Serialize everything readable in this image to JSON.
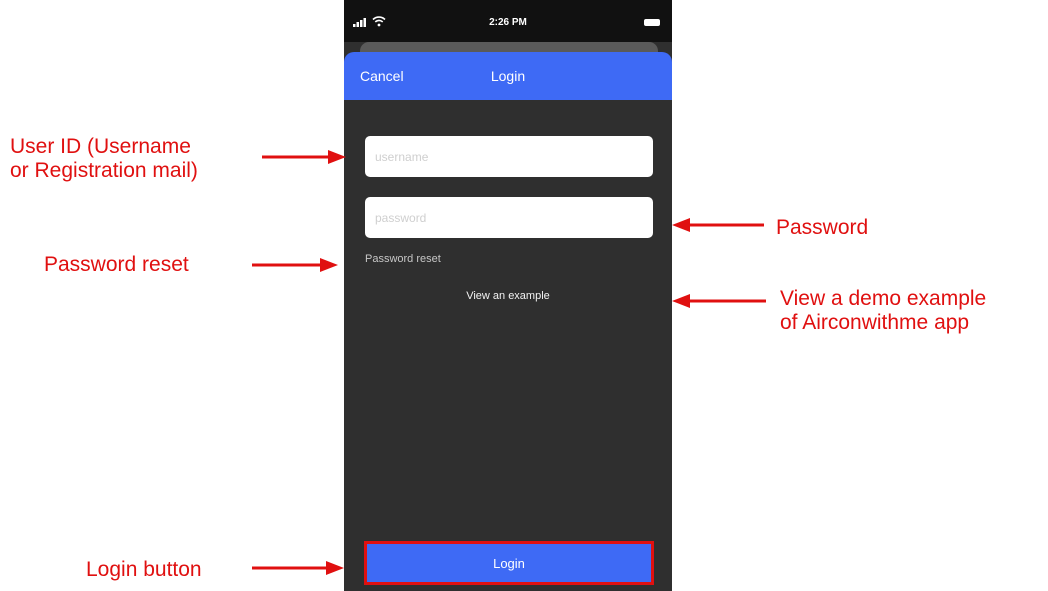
{
  "status_bar": {
    "time": "2:26 PM",
    "icons": [
      "signal-icon",
      "wifi-icon",
      "battery-icon"
    ]
  },
  "nav": {
    "cancel_label": "Cancel",
    "title": "Login"
  },
  "form": {
    "username_placeholder": "username",
    "username_value": "",
    "password_placeholder": "password",
    "password_value": "",
    "reset_label": "Password reset",
    "example_label": "View an example",
    "login_label": "Login"
  },
  "annotations": {
    "user_id": "User ID (Username\nor Registration mail)",
    "password": "Password",
    "password_reset": "Password reset",
    "demo": "View a demo example\nof Airconwithme app",
    "login_button": "Login button"
  },
  "colors": {
    "accent": "#3e6af5",
    "annotation": "#e01010",
    "background": "#2f2f2f"
  }
}
